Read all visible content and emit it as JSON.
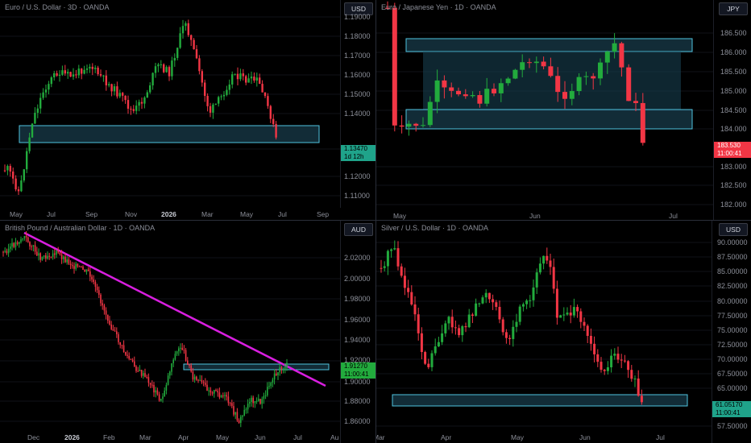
{
  "layout_name": "4-chart grid",
  "colors": {
    "up": "#22ab3d",
    "down": "#f23645",
    "zone_fill": "rgba(41,98,122,0.45)",
    "zone_stroke": "#4fc3df",
    "trend": "#d91ee0"
  },
  "panes": [
    {
      "title": "Euro / U.S. Dollar · 3D · OANDA",
      "currency": "USD",
      "price_ticks": [
        "1.19000",
        "1.18000",
        "1.17000",
        "1.16000",
        "1.15000",
        "1.14000",
        "1.12000",
        "1.11000"
      ],
      "price_tag": {
        "value": "1.13470",
        "countdown": "1d 12h",
        "color": "#1fa38a"
      },
      "time_ticks": [
        "May",
        "Jul",
        "Sep",
        "Nov",
        "2026",
        "Mar",
        "May",
        "Jul",
        "Sep"
      ]
    },
    {
      "title": "Euro / Japanese Yen · 1D · OANDA",
      "currency": "JPY",
      "price_ticks": [
        "186.500",
        "186.000",
        "185.500",
        "185.000",
        "184.500",
        "184.000",
        "183.000",
        "182.500",
        "182.000"
      ],
      "price_tag": {
        "value": "183.530",
        "countdown": "11:00:41",
        "color": "#f23645"
      },
      "time_ticks": [
        "May",
        "Jun",
        "Jul"
      ]
    },
    {
      "title": "British Pound / Australian Dollar · 1D · OANDA",
      "currency": "AUD",
      "price_ticks": [
        "2.02000",
        "2.00000",
        "1.98000",
        "1.96000",
        "1.94000",
        "1.92000",
        "1.90000",
        "1.88000",
        "1.86000"
      ],
      "price_tag": {
        "value": "1.91270",
        "countdown": "11:00:41",
        "color": "#22ab3d"
      },
      "time_ticks": [
        "Dec",
        "2026",
        "Feb",
        "Mar",
        "Apr",
        "May",
        "Jun",
        "Jul",
        "Au"
      ]
    },
    {
      "title": "Silver / U.S. Dollar · 1D · OANDA",
      "currency": "USD",
      "price_ticks": [
        "90.00000",
        "87.50000",
        "85.00000",
        "82.50000",
        "80.00000",
        "77.50000",
        "75.00000",
        "72.50000",
        "70.00000",
        "67.50000",
        "65.00000",
        "62.50000",
        "57.50000"
      ],
      "price_tag": {
        "value": "61.05170",
        "countdown": "11:00:41",
        "color": "#1fa38a"
      },
      "time_ticks": [
        "Mar",
        "Apr",
        "May",
        "Jun",
        "Jul"
      ]
    }
  ]
}
